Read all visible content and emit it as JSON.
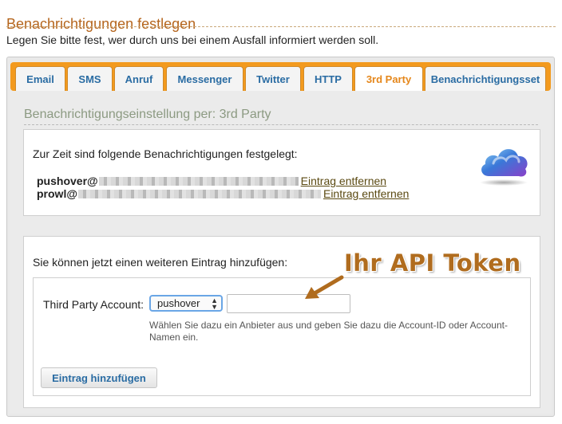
{
  "page": {
    "title": "Benachrichtigungen festlegen",
    "intro": "Legen Sie bitte fest, wer durch uns bei einem Ausfall informiert werden soll."
  },
  "tabs": [
    {
      "label": "Email",
      "active": false
    },
    {
      "label": "SMS",
      "active": false
    },
    {
      "label": "Anruf",
      "active": false
    },
    {
      "label": "Messenger",
      "active": false
    },
    {
      "label": "Twitter",
      "active": false
    },
    {
      "label": "HTTP",
      "active": false
    },
    {
      "label": "3rd Party",
      "active": true
    },
    {
      "label": "Benachrichtigungsset",
      "active": false
    }
  ],
  "section": {
    "title": "Benachrichtigungseinstellung per: 3rd Party"
  },
  "current": {
    "lead": "Zur Zeit sind folgende Benachrichtigungen festgelegt:",
    "entries": [
      {
        "prefix": "pushover@",
        "remove_label": "Eintrag entfernen"
      },
      {
        "prefix": "prowl@",
        "remove_label": "Eintrag entfernen"
      }
    ],
    "icon": "cloud-icon"
  },
  "add": {
    "lead": "Sie können jetzt einen weiteren Eintrag hinzufügen:",
    "account_label": "Third Party Account:",
    "select_value": "pushover",
    "token_value": "",
    "hint": "Wählen Sie dazu ein Anbieter aus und geben Sie dazu die Account-ID oder Account-Namen ein.",
    "button_label": "Eintrag hinzufügen"
  },
  "annotation": {
    "text": "Ihr API Token"
  },
  "colors": {
    "title": "#b5651d",
    "tab_bar": "#f39a1e",
    "tab_text": "#2a6ca3",
    "tab_active_text": "#e5871b",
    "annotation": "#b06c1e"
  }
}
